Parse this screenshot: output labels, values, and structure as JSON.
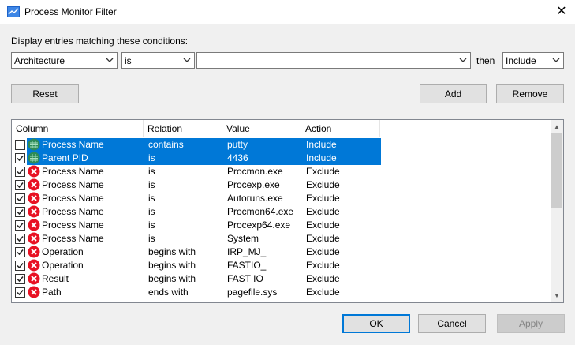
{
  "window": {
    "title": "Process Monitor Filter",
    "close_glyph": "✕"
  },
  "conditions_label": "Display entries matching these conditions:",
  "filter": {
    "column": "Architecture",
    "relation": "is",
    "value": "",
    "then_label": "then",
    "action": "Include"
  },
  "buttons": {
    "reset": "Reset",
    "add": "Add",
    "remove": "Remove",
    "ok": "OK",
    "cancel": "Cancel",
    "apply": "Apply"
  },
  "table": {
    "headers": [
      "Column",
      "Relation",
      "Value",
      "Action"
    ],
    "rows": [
      {
        "checked": false,
        "icon": "include-icon",
        "column": "Process Name",
        "relation": "contains",
        "value": "putty",
        "action": "Include",
        "selected": true
      },
      {
        "checked": true,
        "icon": "include-icon",
        "column": "Parent PID",
        "relation": "is",
        "value": "4436",
        "action": "Include",
        "selected": true
      },
      {
        "checked": true,
        "icon": "exclude-icon",
        "column": "Process Name",
        "relation": "is",
        "value": "Procmon.exe",
        "action": "Exclude",
        "selected": false
      },
      {
        "checked": true,
        "icon": "exclude-icon",
        "column": "Process Name",
        "relation": "is",
        "value": "Procexp.exe",
        "action": "Exclude",
        "selected": false
      },
      {
        "checked": true,
        "icon": "exclude-icon",
        "column": "Process Name",
        "relation": "is",
        "value": "Autoruns.exe",
        "action": "Exclude",
        "selected": false
      },
      {
        "checked": true,
        "icon": "exclude-icon",
        "column": "Process Name",
        "relation": "is",
        "value": "Procmon64.exe",
        "action": "Exclude",
        "selected": false
      },
      {
        "checked": true,
        "icon": "exclude-icon",
        "column": "Process Name",
        "relation": "is",
        "value": "Procexp64.exe",
        "action": "Exclude",
        "selected": false
      },
      {
        "checked": true,
        "icon": "exclude-icon",
        "column": "Process Name",
        "relation": "is",
        "value": "System",
        "action": "Exclude",
        "selected": false
      },
      {
        "checked": true,
        "icon": "exclude-icon",
        "column": "Operation",
        "relation": "begins with",
        "value": "IRP_MJ_",
        "action": "Exclude",
        "selected": false
      },
      {
        "checked": true,
        "icon": "exclude-icon",
        "column": "Operation",
        "relation": "begins with",
        "value": "FASTIO_",
        "action": "Exclude",
        "selected": false
      },
      {
        "checked": true,
        "icon": "exclude-icon",
        "column": "Result",
        "relation": "begins with",
        "value": "FAST IO",
        "action": "Exclude",
        "selected": false
      },
      {
        "checked": true,
        "icon": "exclude-icon",
        "column": "Path",
        "relation": "ends with",
        "value": "pagefile.sys",
        "action": "Exclude",
        "selected": false
      }
    ]
  },
  "colors": {
    "selection": "#0078d7",
    "exclude": "#e81123",
    "include": "#2e8b57"
  }
}
